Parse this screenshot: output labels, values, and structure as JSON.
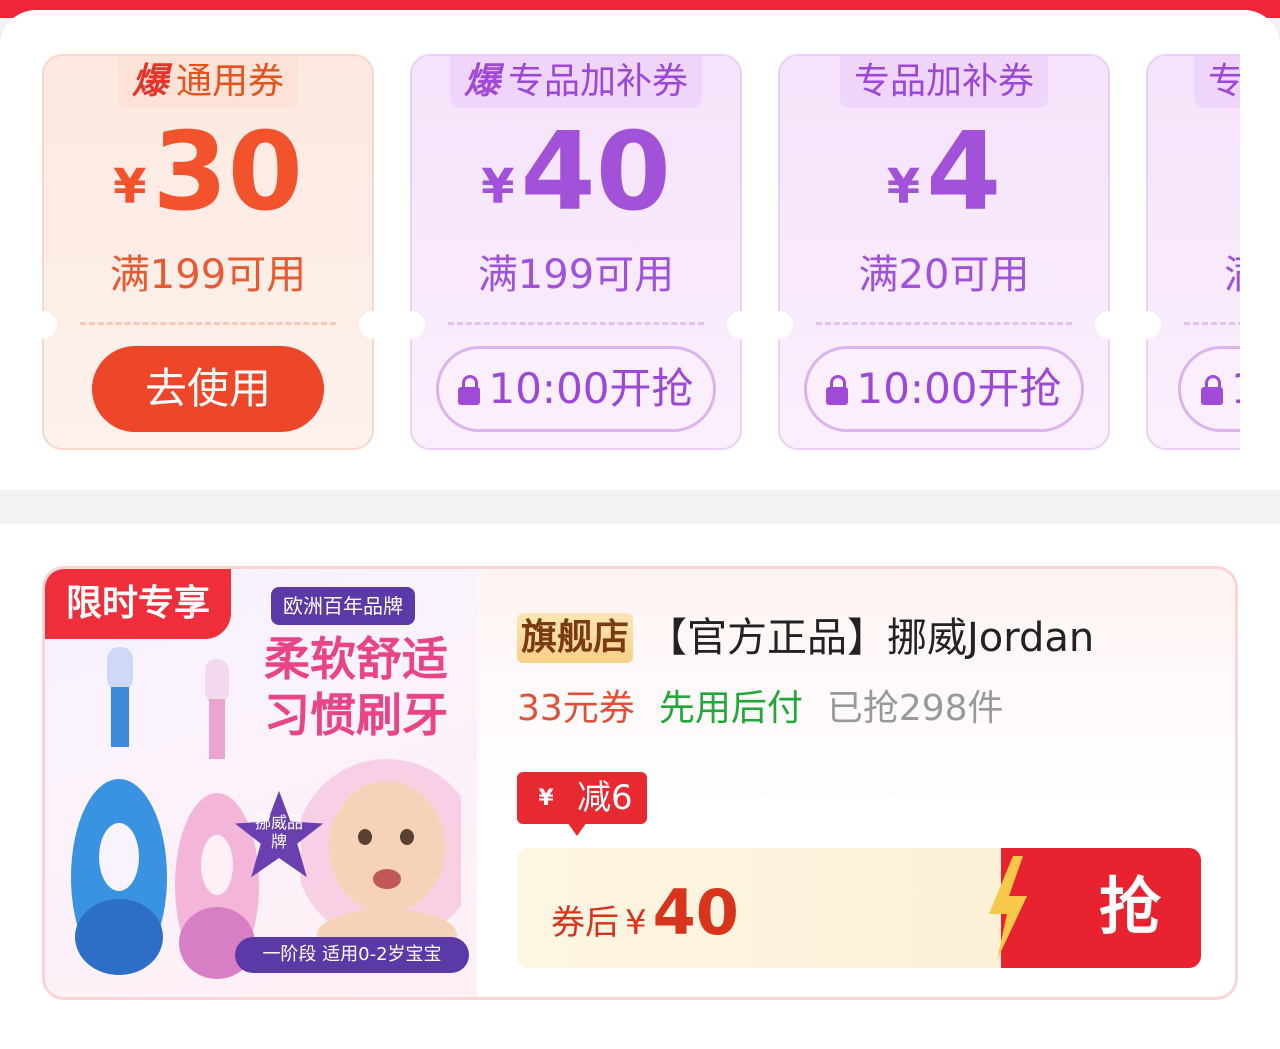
{
  "coupons": [
    {
      "hot": "爆",
      "title": "通用券",
      "currency": "¥",
      "amount": "30",
      "condition": "满199可用",
      "action": "去使用",
      "locked": false,
      "style": "orange"
    },
    {
      "hot": "爆",
      "title": "专品加补券",
      "currency": "¥",
      "amount": "40",
      "condition": "满199可用",
      "action": "10:00开抢",
      "locked": true,
      "style": "purple"
    },
    {
      "hot": "",
      "title": "专品加补券",
      "currency": "¥",
      "amount": "4",
      "condition": "满20可用",
      "action": "10:00开抢",
      "locked": true,
      "style": "purple"
    },
    {
      "hot": "",
      "title": "专",
      "currency": "",
      "amount": "",
      "condition": "满",
      "action": "1",
      "locked": true,
      "style": "purple"
    }
  ],
  "product": {
    "image": {
      "limited_badge": "限时专享",
      "brand_tag": "欧洲百年品牌",
      "slogan_line1": "柔软舒适",
      "slogan_line2": "习惯刷牙",
      "star_text": "挪威品牌",
      "stage": "一阶段 适用0-2岁宝宝"
    },
    "store_badge": "旗舰店",
    "title": "【官方正品】挪威Jordan",
    "coupon_tag": "33元券",
    "pay_later": "先用后付",
    "sold": "已抢298件",
    "discount_icon": "¥",
    "discount": "减6",
    "after_label": "券后",
    "after_currency": "¥",
    "after_price": "40",
    "grab_label": "抢"
  },
  "colors": {
    "accent_red": "#e8232f",
    "coupon_orange": "#f2532c",
    "coupon_purple": "#a152d9"
  }
}
